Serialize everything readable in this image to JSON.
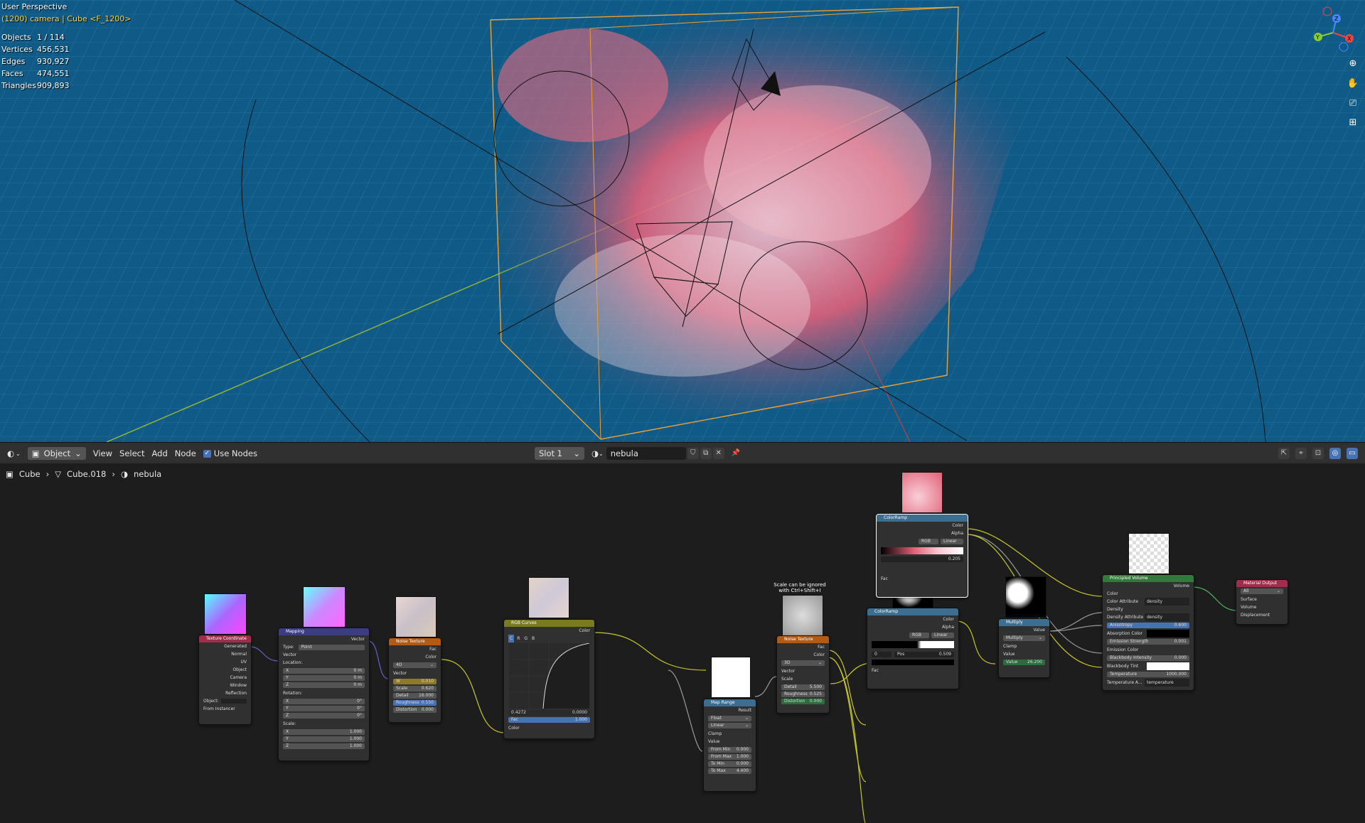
{
  "viewport": {
    "title": "User Perspective",
    "subtitle": "(1200) camera | Cube <F_1200>",
    "stats": [
      {
        "label": "Objects",
        "value": "1 / 114"
      },
      {
        "label": "Vertices",
        "value": "456,531"
      },
      {
        "label": "Edges",
        "value": "930,927"
      },
      {
        "label": "Faces",
        "value": "474,551"
      },
      {
        "label": "Triangles",
        "value": "909,893"
      }
    ],
    "gizmo": {
      "x": "X",
      "y": "Y",
      "z": "Z"
    }
  },
  "header": {
    "mode": "Object",
    "menus": [
      "View",
      "Select",
      "Add",
      "Node"
    ],
    "use_nodes": "Use Nodes",
    "slot": "Slot 1",
    "material": "nebula"
  },
  "breadcrumb": {
    "object": "Cube",
    "mesh": "Cube.018",
    "material": "nebula"
  },
  "note": "Scale can be ignored with Ctrl+Shift+I",
  "nodes": {
    "texcoord": {
      "title": "Texture Coordinate",
      "outputs": [
        "Generated",
        "Normal",
        "UV",
        "Object",
        "Camera",
        "Window",
        "Reflection"
      ],
      "object_label": "Object:",
      "from_instancer": "From Instancer"
    },
    "mapping": {
      "title": "Mapping",
      "out": "Vector",
      "type_label": "Type:",
      "type": "Point",
      "vector": "Vector",
      "location": "Location:",
      "loc": [
        "0 m",
        "0 m",
        "0 m"
      ],
      "rotation": "Rotation:",
      "rot": [
        "0°",
        "0°",
        "0°"
      ],
      "scale": "Scale:",
      "scl": [
        "1.000",
        "1.000",
        "1.000"
      ],
      "axes": [
        "X",
        "Y",
        "Z"
      ]
    },
    "noise1": {
      "title": "Noise Texture",
      "outs": [
        "Fac",
        "Color"
      ],
      "dim": "4D",
      "vector": "Vector",
      "fields": [
        {
          "k": "W",
          "v": "0.010"
        },
        {
          "k": "Scale",
          "v": "0.620"
        },
        {
          "k": "Detail",
          "v": "16.000"
        },
        {
          "k": "Roughness",
          "v": "0.550"
        },
        {
          "k": "Distortion",
          "v": "0.000"
        }
      ]
    },
    "curves": {
      "title": "RGB Curves",
      "out": "Color",
      "tabs": [
        "C",
        "R",
        "G",
        "B"
      ],
      "vals": [
        "0.4272",
        "0.0000"
      ],
      "fac": "Fac",
      "fac_v": "1.000",
      "in": "Color"
    },
    "maprange": {
      "title": "Map Range",
      "out": "Result",
      "type": "Float",
      "interp": "Linear",
      "clamp": "Clamp",
      "value": "Value",
      "fields": [
        {
          "k": "From Min",
          "v": "0.000"
        },
        {
          "k": "From Max",
          "v": "1.000"
        },
        {
          "k": "To Min",
          "v": "0.000"
        },
        {
          "k": "To Max",
          "v": "4.400"
        }
      ]
    },
    "noise2": {
      "title": "Noise Texture",
      "outs": [
        "Fac",
        "Color"
      ],
      "dim": "3D",
      "vector": "Vector",
      "scale": "Scale",
      "fields": [
        {
          "k": "Detail",
          "v": "5.500"
        },
        {
          "k": "Roughness",
          "v": "0.525"
        },
        {
          "k": "Distortion",
          "v": "0.000"
        }
      ]
    },
    "ramp1": {
      "title": "ColorRamp",
      "outs": [
        "Color",
        "Alpha"
      ],
      "mode": "RGB",
      "interp": "Linear",
      "pos": "0.205",
      "fac": "Fac"
    },
    "ramp2": {
      "title": "ColorRamp",
      "outs": [
        "Color",
        "Alpha"
      ],
      "mode": "RGB",
      "interp": "Linear",
      "idx": "0",
      "pos_label": "Pos",
      "pos": "0.509",
      "fac": "Fac"
    },
    "multiply": {
      "title": "Multiply",
      "out": "Value",
      "op": "Multiply",
      "clamp": "Clamp",
      "value": "Value",
      "val_label": "Value",
      "val": "26.200"
    },
    "volume": {
      "title": "Principled Volume",
      "out": "Volume",
      "rows": [
        {
          "k": "Color"
        },
        {
          "k": "Color Attribute",
          "v": "density"
        },
        {
          "k": "Density"
        },
        {
          "k": "Density Attribute",
          "v": "density"
        },
        {
          "k": "Anisotropy",
          "v": "0.600"
        },
        {
          "k": "Absorption Color"
        },
        {
          "k": "Emission Strength",
          "v": "0.001"
        },
        {
          "k": "Emission Color"
        },
        {
          "k": "Blackbody Intensity",
          "v": "0.000"
        },
        {
          "k": "Blackbody Tint"
        },
        {
          "k": "Temperature",
          "v": "1000.000"
        },
        {
          "k": "Temperature A...",
          "v": "temperature"
        }
      ]
    },
    "output": {
      "title": "Material Output",
      "target": "All",
      "inputs": [
        "Surface",
        "Volume",
        "Displacement"
      ]
    }
  },
  "colors": {
    "viewport_bg": "#0f5a86",
    "selection": "#f0a030",
    "header_blue": "#4772b3"
  }
}
